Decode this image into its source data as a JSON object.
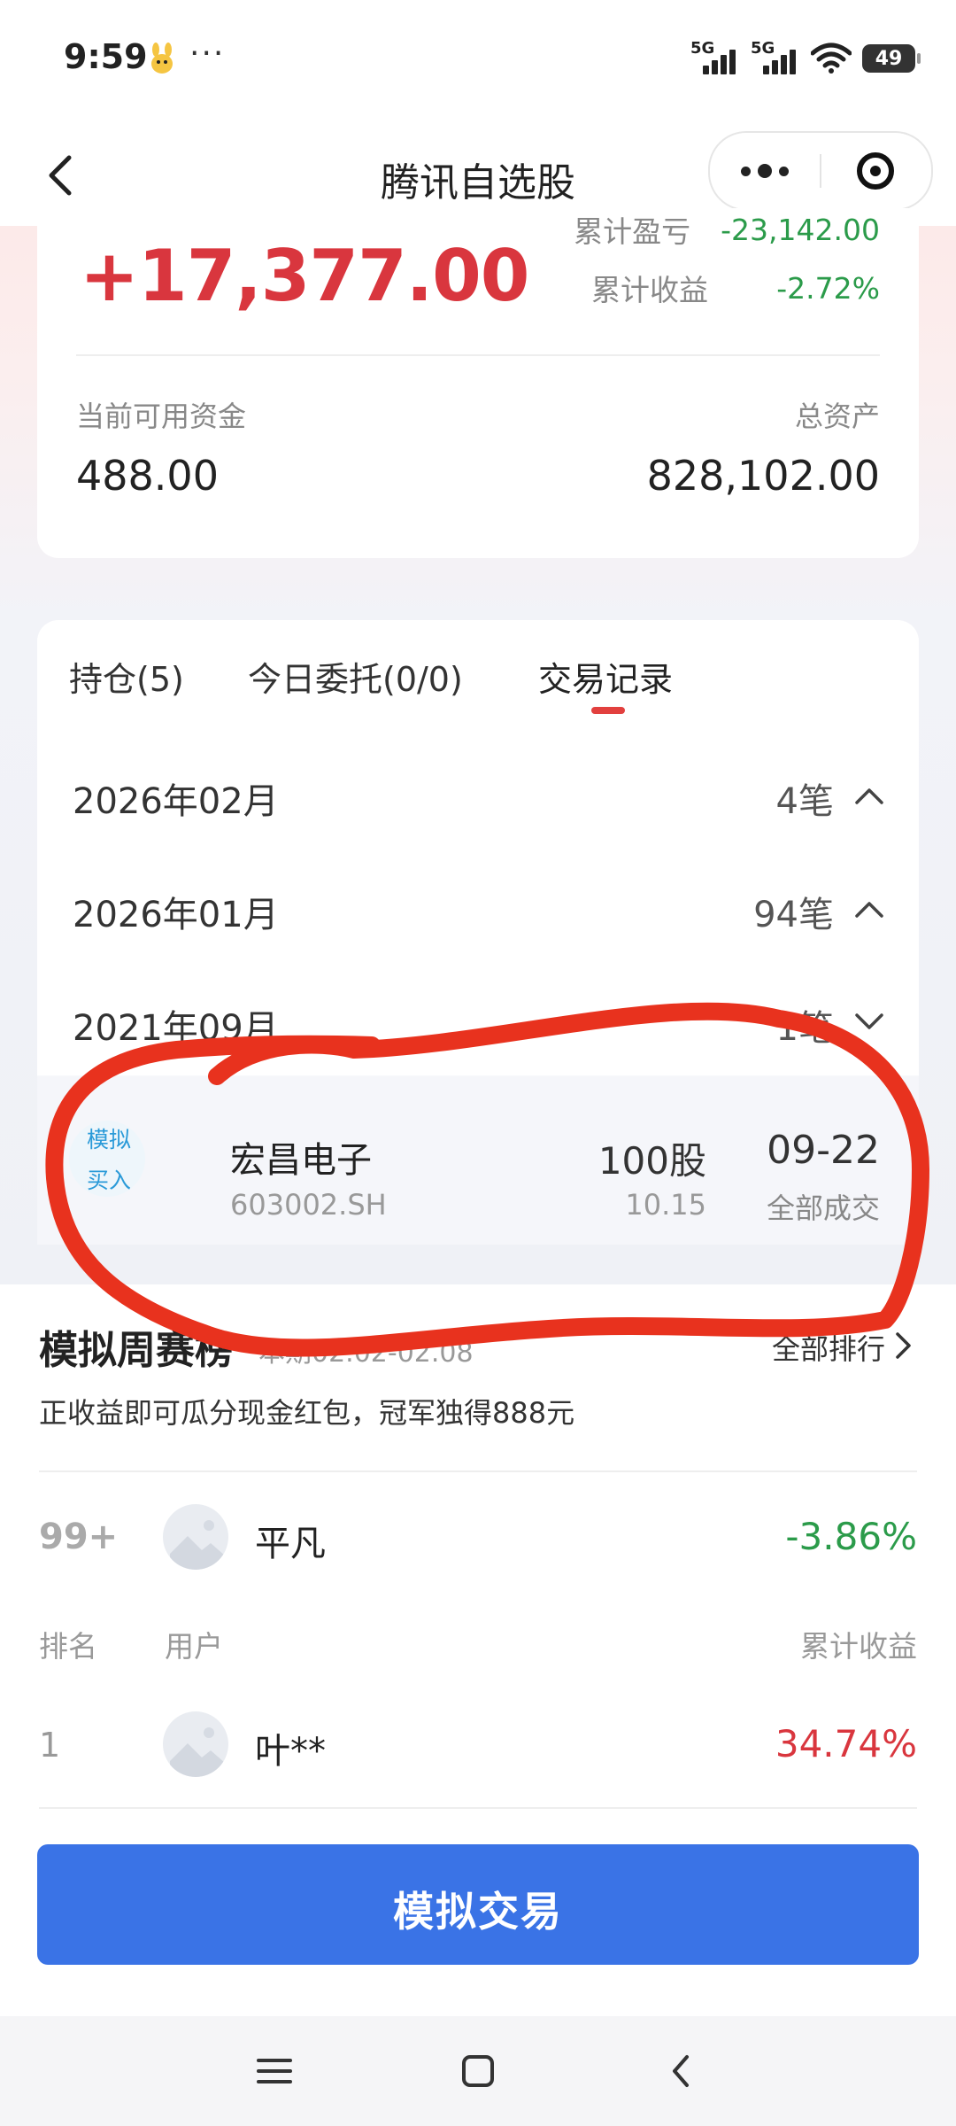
{
  "status_bar": {
    "time": "9:59",
    "dots": "···",
    "signal1_label": "5G",
    "signal2_label": "5G",
    "battery": "49"
  },
  "nav": {
    "title": "腾讯自选股",
    "back_icon": "chevron-left-icon",
    "more_icon": "more-dots-icon",
    "close_icon": "target-icon"
  },
  "account": {
    "daily_profit": "+17,377.00",
    "cum_pnl_label": "累计盈亏",
    "cum_pnl_value": "-23,142.00",
    "cum_return_label": "累计收益",
    "cum_return_value": "-2.72%",
    "available_label": "当前可用资金",
    "available_value": "488.00",
    "total_label": "总资产",
    "total_value": "828,102.00"
  },
  "tabs": [
    {
      "label": "持仓(5)"
    },
    {
      "label": "今日委托(0/0)"
    },
    {
      "label": "交易记录"
    }
  ],
  "months": [
    {
      "month": "2026年02月",
      "count": "4笔",
      "expanded": false
    },
    {
      "month": "2026年01月",
      "count": "94笔",
      "expanded": false
    },
    {
      "month": "2021年09月",
      "count": "1笔",
      "expanded": true
    }
  ],
  "trade": {
    "badge_line1": "模拟",
    "badge_line2": "买入",
    "name": "宏昌电子",
    "code": "603002.SH",
    "quantity": "100股",
    "price": "10.15",
    "date": "09-22",
    "status": "全部成交"
  },
  "leaderboard": {
    "title": "模拟周赛榜",
    "period": "本期02.02-02.08",
    "view_all": "全部排行",
    "description": "正收益即可瓜分现金红包，冠军独得888元",
    "me": {
      "rank": "99+",
      "name": "平凡",
      "return": "-3.86%"
    },
    "headers": {
      "rank": "排名",
      "user": "用户",
      "return": "累计收益"
    },
    "rows": [
      {
        "rank": "1",
        "name": "叶**",
        "return": "34.74%"
      }
    ]
  },
  "cta": {
    "label": "模拟交易"
  },
  "colors": {
    "red": "#d9363e",
    "green": "#2b9b4a",
    "blue": "#3a73e6",
    "annotation": "#e8321e"
  }
}
